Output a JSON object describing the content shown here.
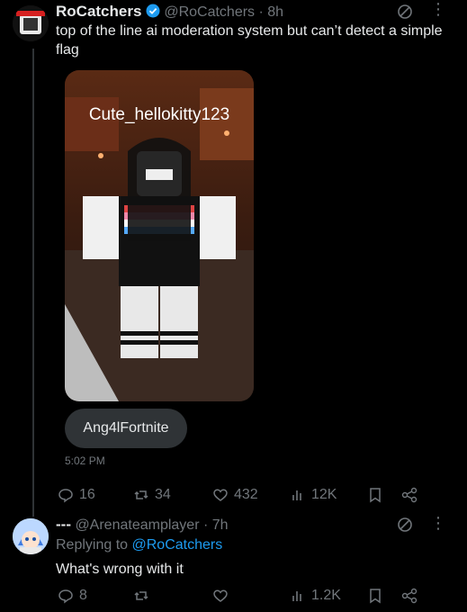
{
  "post": {
    "author_name": "RoCatchers",
    "handle": "@RoCatchers",
    "time_ago": "8h",
    "text": "top of the line ai moderation system but can’t detect a simple flag",
    "image_overlay_username": "Cute_hellokitty123",
    "chat_bubble": "Ang4lFortnite",
    "timestamp": "5:02 PM",
    "stats": {
      "replies": "16",
      "reposts": "34",
      "likes": "432",
      "views": "12K"
    }
  },
  "reply": {
    "display_name": "---",
    "handle": "@Arenateamplayer",
    "time_ago": "7h",
    "replying_prefix": "Replying to",
    "replying_to": "@RoCatchers",
    "text": "What's wrong with it",
    "stats": {
      "replies": "8",
      "reposts": "",
      "likes": "",
      "views": "1.2K"
    }
  },
  "colors": {
    "accent": "#1d9bf0",
    "muted": "#71767b",
    "background": "#000000"
  },
  "icons": [
    "grok-icon",
    "more-icon",
    "reply-icon",
    "repost-icon",
    "like-icon",
    "views-icon",
    "bookmark-icon",
    "share-icon",
    "verified-icon"
  ]
}
